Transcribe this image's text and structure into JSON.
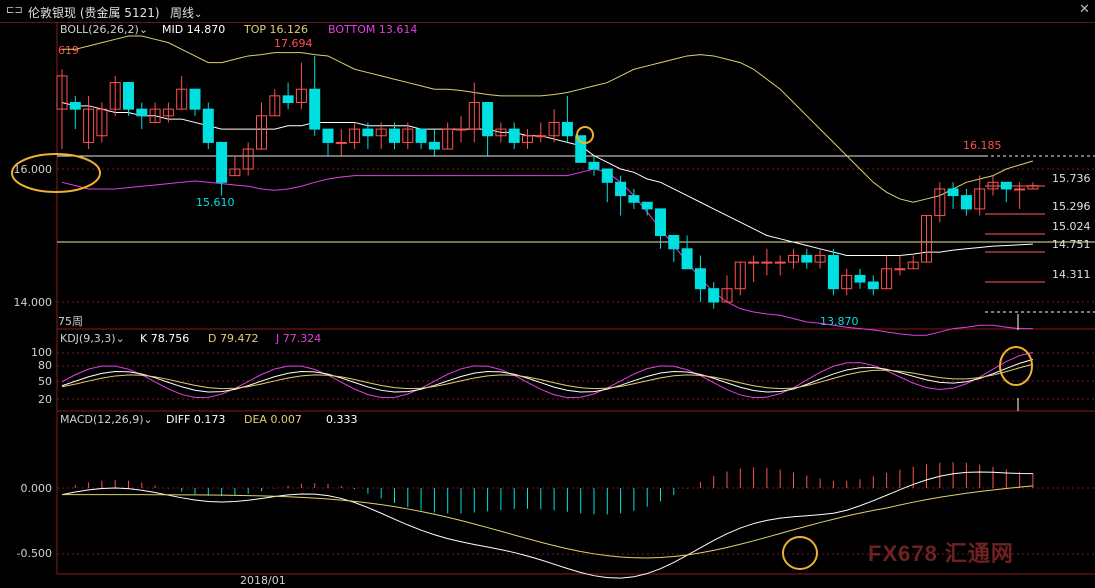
{
  "header": {
    "chart_mode_icon": "chart-mode-icon",
    "instrument": "伦敦银现 (贵金属 5121)",
    "period": "周线",
    "dropdown_icon": "chevron-down-icon",
    "close_icon": "close-icon"
  },
  "boll": {
    "name": "BOLL(26,26,2)",
    "mid": "MID 14.870",
    "top": "TOP 16.126",
    "bottom": "BOTTOM 13.614"
  },
  "price_labels": {
    "left_partial": "619",
    "high": "17.694",
    "low_left": "15.610",
    "low_bottom": "13.870",
    "right_high": "16.185"
  },
  "price_axis": [
    "16.000",
    "14.000"
  ],
  "level_lines": [
    "15.736",
    "15.296",
    "15.024",
    "14.751",
    "14.311"
  ],
  "period_count": "75周",
  "kdj": {
    "name": "KDJ(9,3,3)",
    "k": "K 78.756",
    "d": "D 79.472",
    "j": "J 77.324",
    "axis": [
      "100",
      "80",
      "50",
      "20"
    ]
  },
  "macd": {
    "name": "MACD(12,26,9)",
    "diff": "DIFF 0.173",
    "dea": "DEA 0.007",
    "macd": "0.333",
    "axis": [
      "0.000",
      "-0.500"
    ]
  },
  "time_axis": [
    "2018/01"
  ],
  "watermark": "FX678 汇通网",
  "colors": {
    "up": "#ff5050",
    "down": "#00e0e0",
    "mid": "#ffffff",
    "top": "#e0d070",
    "bottom": "#e040e0",
    "highlight": "#f0b030"
  },
  "chart_data": {
    "type": "candlestick",
    "candles": [
      [
        16.9,
        17.4,
        17.5,
        16.3
      ],
      [
        17.0,
        16.9,
        17.1,
        16.6
      ],
      [
        16.4,
        16.9,
        17.1,
        16.3
      ],
      [
        16.5,
        16.9,
        17.0,
        16.4
      ],
      [
        16.9,
        17.3,
        17.4,
        16.8
      ],
      [
        17.3,
        16.9,
        17.3,
        16.8
      ],
      [
        16.9,
        16.8,
        17.0,
        16.6
      ],
      [
        16.7,
        16.9,
        17.0,
        16.7
      ],
      [
        16.8,
        16.9,
        17.0,
        16.7
      ],
      [
        16.9,
        17.2,
        17.4,
        16.9
      ],
      [
        17.2,
        16.9,
        17.2,
        16.8
      ],
      [
        16.9,
        16.4,
        17.0,
        16.3
      ],
      [
        16.4,
        15.8,
        16.4,
        15.6
      ],
      [
        15.9,
        16.0,
        16.2,
        15.9
      ],
      [
        16.0,
        16.3,
        16.4,
        15.9
      ],
      [
        16.3,
        16.8,
        17.0,
        16.3
      ],
      [
        16.8,
        17.1,
        17.2,
        16.8
      ],
      [
        17.1,
        17.0,
        17.3,
        16.9
      ],
      [
        17.0,
        17.2,
        17.6,
        16.9
      ],
      [
        17.2,
        16.6,
        17.7,
        16.5
      ],
      [
        16.6,
        16.4,
        16.6,
        16.2
      ],
      [
        16.4,
        16.4,
        16.6,
        16.2
      ],
      [
        16.4,
        16.6,
        16.7,
        16.3
      ],
      [
        16.6,
        16.5,
        16.7,
        16.3
      ],
      [
        16.5,
        16.6,
        16.7,
        16.3
      ],
      [
        16.6,
        16.4,
        16.7,
        16.3
      ],
      [
        16.4,
        16.6,
        16.7,
        16.3
      ],
      [
        16.6,
        16.4,
        16.6,
        16.3
      ],
      [
        16.4,
        16.3,
        16.6,
        16.2
      ],
      [
        16.3,
        16.6,
        16.7,
        16.3
      ],
      [
        16.6,
        16.6,
        16.8,
        16.4
      ],
      [
        16.6,
        17.0,
        17.3,
        16.4
      ],
      [
        17.0,
        16.5,
        17.0,
        16.2
      ],
      [
        16.5,
        16.6,
        16.7,
        16.4
      ],
      [
        16.6,
        16.4,
        16.7,
        16.3
      ],
      [
        16.4,
        16.5,
        16.6,
        16.3
      ],
      [
        16.5,
        16.5,
        16.7,
        16.4
      ],
      [
        16.5,
        16.7,
        16.9,
        16.4
      ],
      [
        16.7,
        16.5,
        17.1,
        16.4
      ],
      [
        16.5,
        16.1,
        16.5,
        16.1
      ],
      [
        16.1,
        16.0,
        16.2,
        15.9
      ],
      [
        16.0,
        15.8,
        16.0,
        15.5
      ],
      [
        15.8,
        15.6,
        15.9,
        15.3
      ],
      [
        15.6,
        15.5,
        15.7,
        15.4
      ],
      [
        15.5,
        15.4,
        15.5,
        15.3
      ],
      [
        15.4,
        15.0,
        15.4,
        14.8
      ],
      [
        15.0,
        14.8,
        15.0,
        14.6
      ],
      [
        14.8,
        14.5,
        15.0,
        14.5
      ],
      [
        14.5,
        14.2,
        14.7,
        14.0
      ],
      [
        14.2,
        14.0,
        14.3,
        13.9
      ],
      [
        14.0,
        14.2,
        14.4,
        14.0
      ],
      [
        14.2,
        14.6,
        14.6,
        14.1
      ],
      [
        14.6,
        14.6,
        14.7,
        14.3
      ],
      [
        14.6,
        14.6,
        14.8,
        14.4
      ],
      [
        14.6,
        14.6,
        14.7,
        14.4
      ],
      [
        14.6,
        14.7,
        14.8,
        14.5
      ],
      [
        14.7,
        14.6,
        14.8,
        14.5
      ],
      [
        14.6,
        14.7,
        14.8,
        14.5
      ],
      [
        14.7,
        14.2,
        14.8,
        14.1
      ],
      [
        14.2,
        14.4,
        14.5,
        14.1
      ],
      [
        14.4,
        14.3,
        14.5,
        14.2
      ],
      [
        14.3,
        14.2,
        14.4,
        14.1
      ],
      [
        14.2,
        14.5,
        14.7,
        14.2
      ],
      [
        14.5,
        14.5,
        14.7,
        14.4
      ],
      [
        14.5,
        14.6,
        14.7,
        14.5
      ],
      [
        14.6,
        15.3,
        15.3,
        14.6
      ],
      [
        15.3,
        15.7,
        15.8,
        15.2
      ],
      [
        15.7,
        15.6,
        15.8,
        15.4
      ],
      [
        15.6,
        15.4,
        15.7,
        15.3
      ],
      [
        15.4,
        15.7,
        15.9,
        15.3
      ],
      [
        15.7,
        15.8,
        15.9,
        15.6
      ],
      [
        15.8,
        15.7,
        15.8,
        15.5
      ],
      [
        15.7,
        15.7,
        15.8,
        15.4
      ],
      [
        15.7,
        15.75,
        15.8,
        15.7
      ]
    ],
    "boll_mid": [
      17.0,
      16.95,
      16.95,
      16.9,
      16.85,
      16.85,
      16.8,
      16.8,
      16.75,
      16.75,
      16.7,
      16.65,
      16.6,
      16.6,
      16.6,
      16.6,
      16.6,
      16.65,
      16.65,
      16.7,
      16.7,
      16.7,
      16.7,
      16.65,
      16.65,
      16.65,
      16.65,
      16.6,
      16.6,
      16.6,
      16.6,
      16.6,
      16.6,
      16.55,
      16.55,
      16.5,
      16.5,
      16.45,
      16.4,
      16.35,
      16.2,
      16.1,
      16.0,
      15.95,
      15.85,
      15.8,
      15.7,
      15.6,
      15.5,
      15.4,
      15.3,
      15.2,
      15.1,
      15.0,
      14.95,
      14.9,
      14.85,
      14.8,
      14.75,
      14.7,
      14.7,
      14.7,
      14.7,
      14.7,
      14.72,
      14.75,
      14.75,
      14.78,
      14.8,
      14.82,
      14.84,
      14.85,
      14.86,
      14.87
    ],
    "boll_top": [
      17.8,
      17.8,
      17.85,
      17.9,
      17.95,
      18.0,
      18.0,
      17.95,
      17.9,
      17.8,
      17.7,
      17.6,
      17.6,
      17.65,
      17.7,
      17.72,
      17.75,
      17.75,
      17.75,
      17.72,
      17.7,
      17.6,
      17.5,
      17.45,
      17.4,
      17.35,
      17.3,
      17.25,
      17.2,
      17.2,
      17.18,
      17.15,
      17.12,
      17.1,
      17.1,
      17.1,
      17.1,
      17.12,
      17.15,
      17.2,
      17.25,
      17.3,
      17.4,
      17.5,
      17.55,
      17.6,
      17.65,
      17.7,
      17.72,
      17.7,
      17.65,
      17.6,
      17.5,
      17.35,
      17.2,
      17.0,
      16.8,
      16.6,
      16.4,
      16.2,
      16.0,
      15.8,
      15.65,
      15.55,
      15.5,
      15.55,
      15.6,
      15.7,
      15.8,
      15.85,
      15.9,
      16.0,
      16.06,
      16.12
    ],
    "boll_bottom": [
      15.8,
      15.75,
      15.7,
      15.7,
      15.7,
      15.72,
      15.74,
      15.76,
      15.78,
      15.8,
      15.82,
      15.8,
      15.78,
      15.76,
      15.74,
      15.7,
      15.68,
      15.7,
      15.74,
      15.8,
      15.85,
      15.88,
      15.9,
      15.9,
      15.9,
      15.9,
      15.9,
      15.9,
      15.9,
      15.9,
      15.9,
      15.9,
      15.9,
      15.9,
      15.9,
      15.9,
      15.9,
      15.9,
      15.9,
      15.95,
      16.0,
      15.95,
      15.8,
      15.6,
      15.35,
      15.1,
      14.85,
      14.6,
      14.35,
      14.15,
      14.0,
      13.9,
      13.85,
      13.82,
      13.8,
      13.75,
      13.7,
      13.68,
      13.65,
      13.62,
      13.6,
      13.58,
      13.55,
      13.52,
      13.5,
      13.5,
      13.55,
      13.6,
      13.62,
      13.65,
      13.65,
      13.62,
      13.6,
      13.6
    ]
  }
}
